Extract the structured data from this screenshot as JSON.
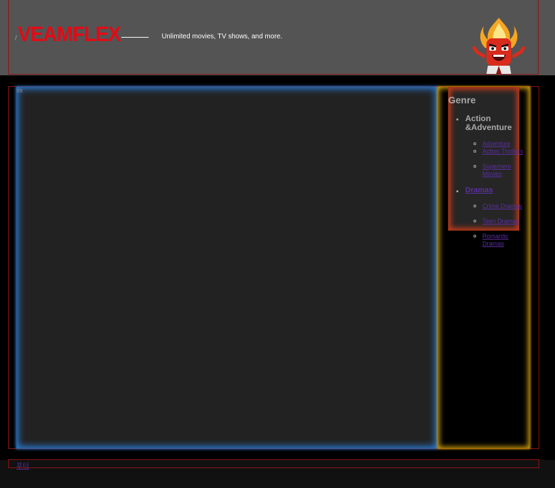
{
  "header": {
    "logo_prefix": "/",
    "logo": "VEAMFLEX",
    "tagline": "Unlimited movies, TV shows, and more."
  },
  "main": {
    "label": "ss"
  },
  "sidebar": {
    "title": "Genre",
    "categories": [
      {
        "label": "Action &Adventure",
        "items": [
          "Adventure",
          "Action Thrillers",
          "Superhero Movies"
        ]
      },
      {
        "label": "Dramas",
        "items": [
          "Crime Dramas",
          "Teen Dramas",
          "Romantic Dramas"
        ]
      }
    ]
  },
  "footer": {
    "link": "푸터"
  },
  "colors": {
    "brand": "#e50914",
    "header_bg": "#545454",
    "main_glow": "#2b7bd3",
    "sidebar_glow": "#d4a10a",
    "genre_glow": "#c0391b",
    "link": "#5b2fa0"
  }
}
